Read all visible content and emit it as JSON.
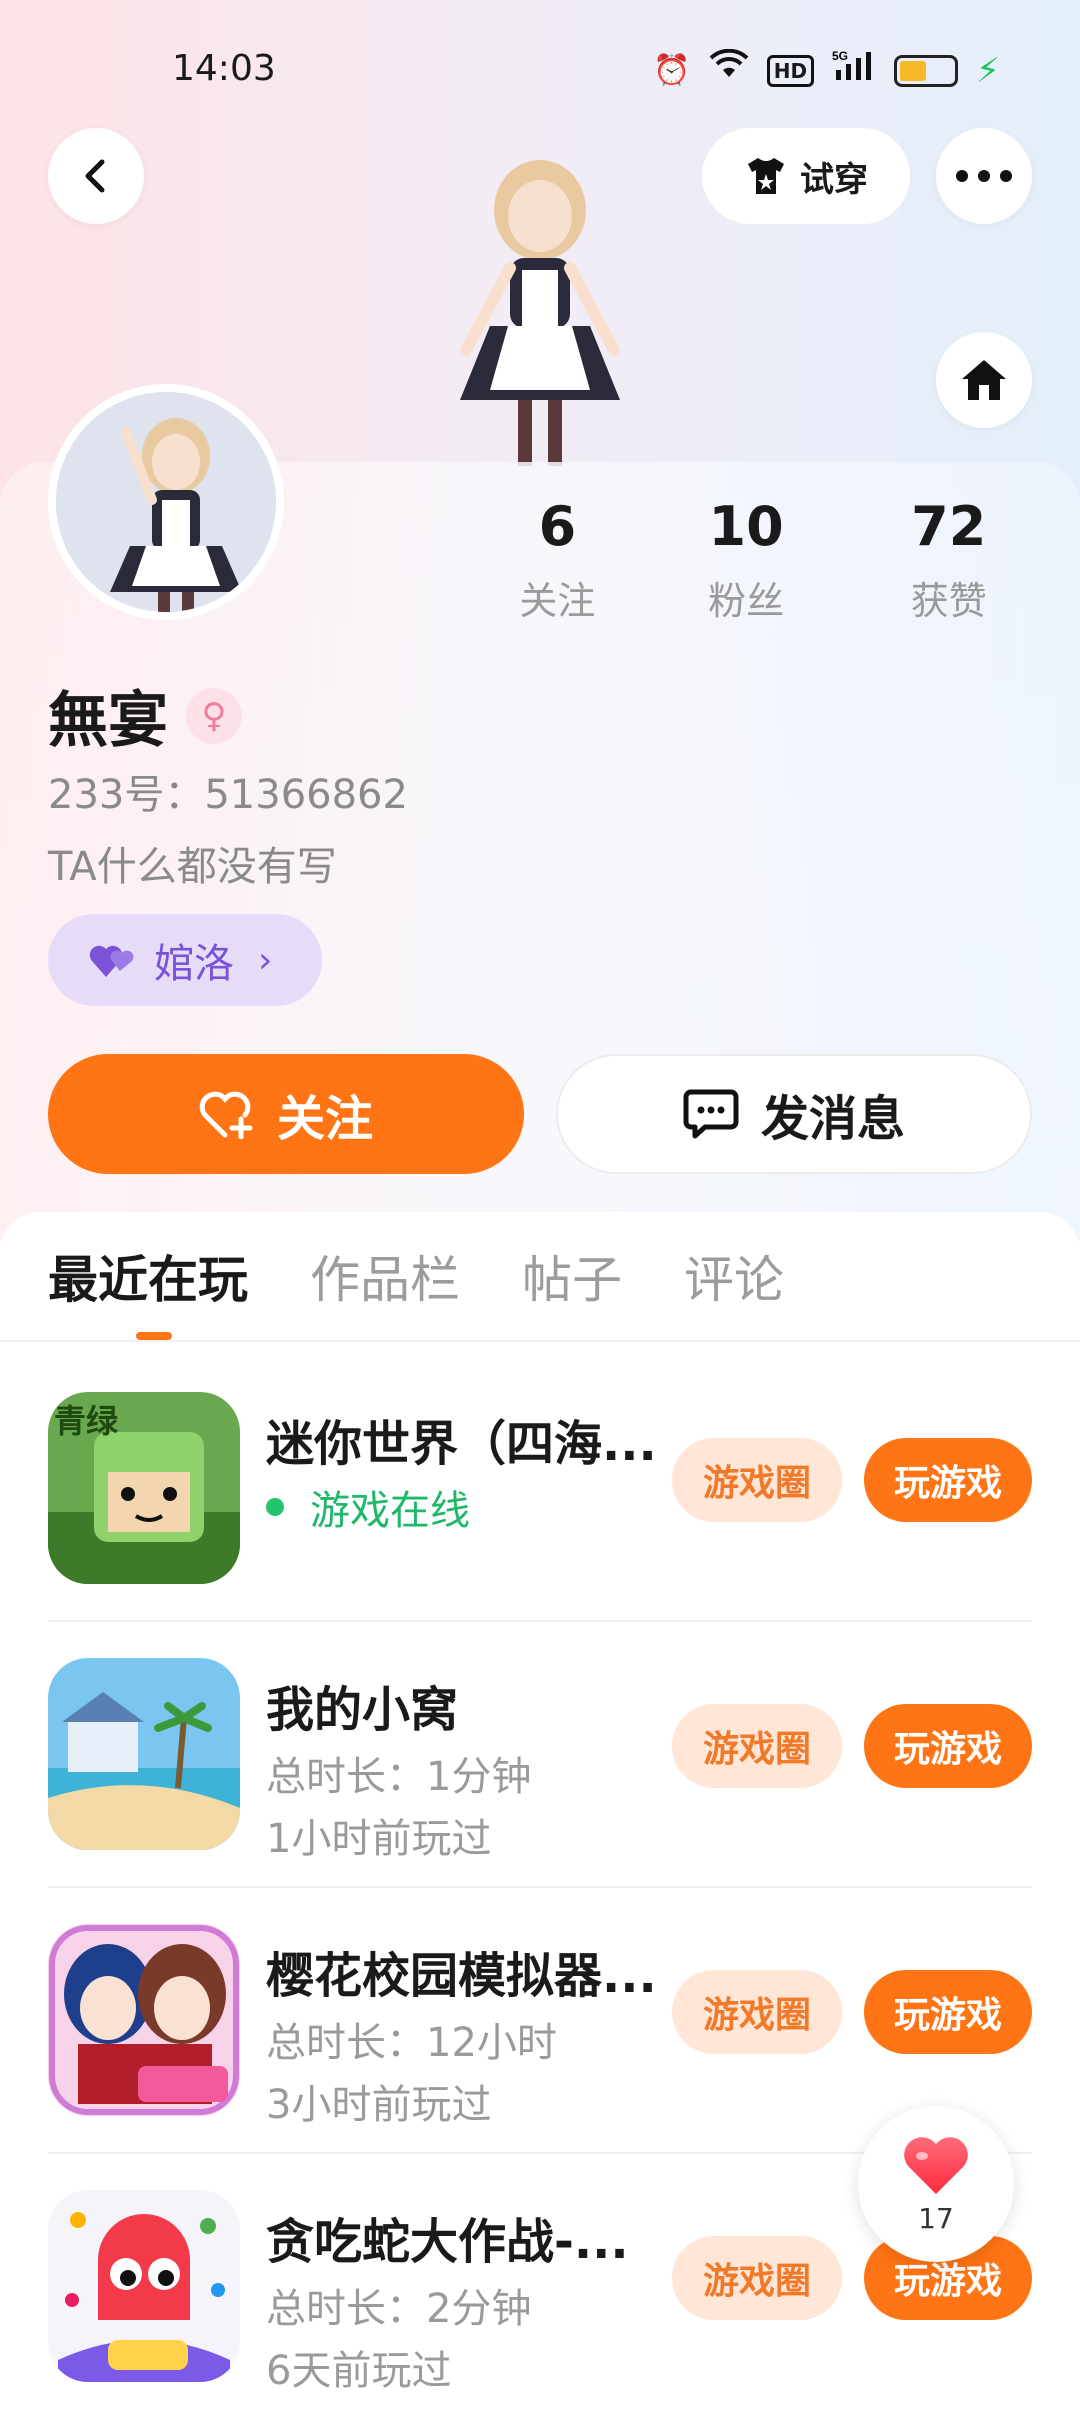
{
  "status_bar": {
    "time": "14:03",
    "battery_level": 0.45
  },
  "header": {
    "try_on_label": "试穿",
    "icons": [
      "back-icon",
      "shirt-icon",
      "more-icon",
      "home-icon"
    ]
  },
  "profile": {
    "name": "無宴",
    "gender_icon": "female-icon",
    "uid": "233号：51366862",
    "bio": "TA什么都没有写",
    "tag": "婠洛",
    "stats": [
      {
        "value": "6",
        "label": "关注"
      },
      {
        "value": "10",
        "label": "粉丝"
      },
      {
        "value": "72",
        "label": "获赞"
      }
    ]
  },
  "actions": {
    "follow_label": "关注",
    "message_label": "发消息"
  },
  "tabs": [
    {
      "label": "最近在玩",
      "active": true
    },
    {
      "label": "作品栏",
      "active": false
    },
    {
      "label": "帖子",
      "active": false
    },
    {
      "label": "评论",
      "active": false
    }
  ],
  "games": [
    {
      "title": "迷你世界（四海...",
      "line1": "游戏在线",
      "line2": "",
      "online": true
    },
    {
      "title": "我的小窝",
      "line1": "总时长：1分钟",
      "line2": "1小时前玩过",
      "online": false
    },
    {
      "title": "樱花校园模拟器...",
      "line1": "总时长：12小时",
      "line2": "3小时前玩过",
      "online": false
    },
    {
      "title": "贪吃蛇大作战-...",
      "line1": "总时长：2分钟",
      "line2": "6天前玩过",
      "online": false
    }
  ],
  "game_buttons": {
    "circle_label": "游戏圈",
    "play_label": "玩游戏"
  },
  "like_float": {
    "count": "17"
  },
  "colors": {
    "accent": "#ff7414",
    "online_green": "#1fb86a",
    "tag_purple": "#7b53d9"
  }
}
